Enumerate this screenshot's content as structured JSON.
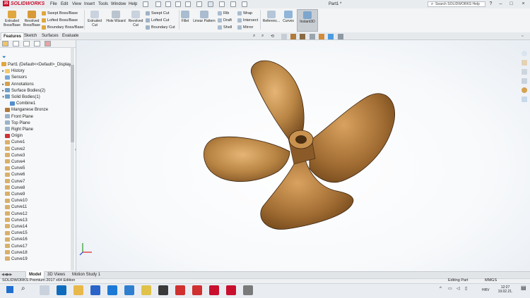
{
  "app": {
    "brand": "SOLIDWORKS",
    "document_title": "Part1 *"
  },
  "menu": [
    "File",
    "Edit",
    "View",
    "Insert",
    "Tools",
    "Window",
    "Help"
  ],
  "search": {
    "placeholder": "Search SOLIDWORKS Help"
  },
  "ribbon": {
    "extruded_boss": "Extruded Boss/Base",
    "revolved_boss": "Revolved Boss/Base",
    "swept_boss": "Swept Boss/Base",
    "lofted_boss": "Lofted Boss/Base",
    "boundary_boss": "Boundary Boss/Base",
    "extruded_cut": "Extruded Cut",
    "hole_wizard": "Hole Wizard",
    "revolved_cut": "Revolved Cut",
    "swept_cut": "Swept Cut",
    "lofted_cut": "Lofted Cut",
    "boundary_cut": "Boundary Cut",
    "fillet": "Fillet",
    "linear_pattern": "Linear Pattern",
    "rib": "Rib",
    "draft": "Draft",
    "shell": "Shell",
    "wrap": "Wrap",
    "intersect": "Intersect",
    "mirror": "Mirror",
    "reference": "Referenc...",
    "curves": "Curves",
    "instant3d": "Instant3D"
  },
  "command_tabs": [
    "Features",
    "Sketch",
    "Surfaces",
    "Evaluate"
  ],
  "tree": {
    "root": "Part1  (Default<<Default>_Display",
    "items": [
      "History",
      "Sensors",
      "Annotations",
      "Surface Bodies(2)",
      "Solid Bodies(1)",
      "Combine1",
      "Manganese Bronze",
      "Front Plane",
      "Top Plane",
      "Right Plane",
      "Origin"
    ],
    "curves": [
      "Curve1",
      "Curve2",
      "Curve3",
      "Curve4",
      "Curve5",
      "Curve6",
      "Curve7",
      "Curve8",
      "Curve9",
      "Curve10",
      "Curve11",
      "Curve12",
      "Curve13",
      "Curve14",
      "Curve15",
      "Curve16",
      "Curve17",
      "Curve18",
      "Curve19"
    ]
  },
  "bottom_tabs": [
    "Model",
    "3D Views",
    "Motion Study 1"
  ],
  "status": {
    "left": "SOLIDWORKS Premium 2017 x64 Edition",
    "editing": "Editing Part",
    "units": "MMGS"
  },
  "tray": {
    "time": "12:27",
    "date": "19.02.21.",
    "lang": "HRV"
  },
  "colors": {
    "propeller": "#b07a3a",
    "brand_red": "#c8102e",
    "accent": "#1e6fc2"
  }
}
